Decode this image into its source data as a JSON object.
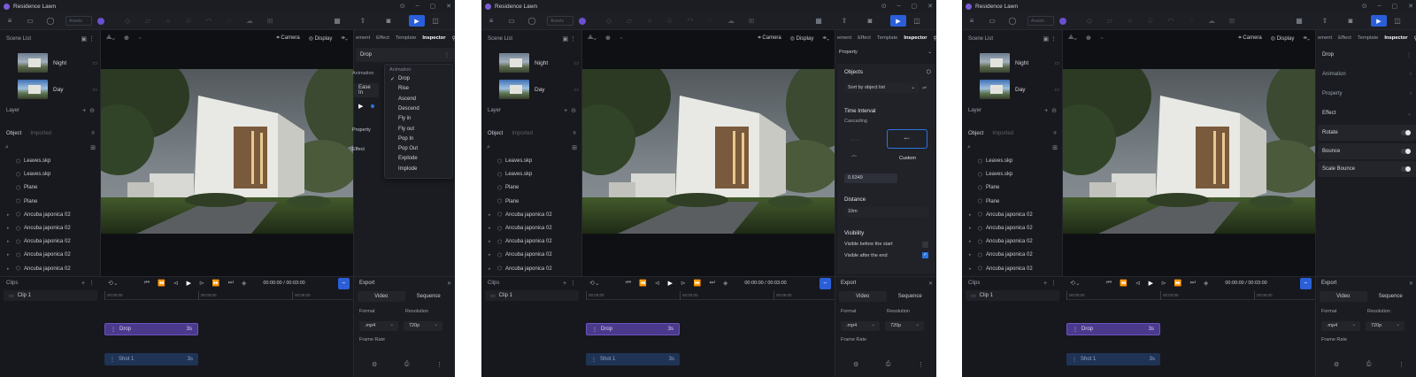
{
  "window_title": "Residence Lawn",
  "toolbar": {
    "search_placeholder": "Assets"
  },
  "left_panel": {
    "scene_list_label": "Scene List",
    "scenes": [
      {
        "name": "Night"
      },
      {
        "name": "Day"
      }
    ],
    "layer_label": "Layer",
    "tabs": {
      "object": "Object",
      "imported": "Imported"
    },
    "objects": [
      "Leaves.skp",
      "Leaves.skp",
      "Plane",
      "Plane",
      "Ancuba japonica 02",
      "Ancuba japonica 02",
      "Ancuba japonica 02",
      "Ancuba japonica 02",
      "Ancuba japonica 02"
    ]
  },
  "viewport": {
    "camera_label": "Camera",
    "display_label": "Display"
  },
  "inspector_tabs": {
    "element": "ement",
    "effect": "Effect",
    "template": "Template",
    "inspector": "Inspector"
  },
  "timeline": {
    "time": "00:00:00 / 00:03:00",
    "ruler_ticks": [
      "00:00:00",
      "00:03:00",
      "00:06:00"
    ],
    "drop_track": {
      "label": "Drop",
      "duration": "3s"
    },
    "shot_track": {
      "label": "Shot 1",
      "duration": "3s"
    }
  },
  "clips": {
    "label": "Clips",
    "clip1": "Clip 1"
  },
  "export": {
    "label": "Export",
    "tab_video": "Video",
    "tab_sequence": "Sequence",
    "format_label": "Format",
    "resolution_label": "Resolution",
    "format_value": ".mp4",
    "resolution_value": "720p",
    "frame_rate_label": "Frame Rate"
  },
  "panel1": {
    "drop_label": "Drop",
    "animation_label": "Animation",
    "ease_label": "Ease In",
    "property_label": "Property",
    "effect_label": "Effect",
    "dropdown": {
      "caption": "Animation",
      "items": [
        "Drop",
        "Rise",
        "Ascend",
        "Descend",
        "Fly in",
        "Fly out",
        "Pop In",
        "Pop Out",
        "Explode",
        "Implode"
      ]
    }
  },
  "panel2": {
    "property_label": "Property",
    "objects_label": "Objects",
    "sort_value": "Sort by object list",
    "time_interval_label": "Time Interval",
    "cascading_label": "Cascading",
    "custom_label": "Custom",
    "interval_value": "0.6349",
    "distance_label": "Distance",
    "distance_value": "10m",
    "visibility_label": "Visibility",
    "visible_before": "Visible before the start",
    "visible_after": "Visible after the end"
  },
  "panel3": {
    "drop_label": "Drop",
    "animation_label": "Animation",
    "property_label": "Property",
    "effect_label": "Effect",
    "effects": [
      "Rotate",
      "Bounce",
      "Scale Bounce"
    ]
  },
  "colors": {
    "accent": "#2b5fd9",
    "clip_purple": "#4b3a8c",
    "background": "#16181d"
  }
}
